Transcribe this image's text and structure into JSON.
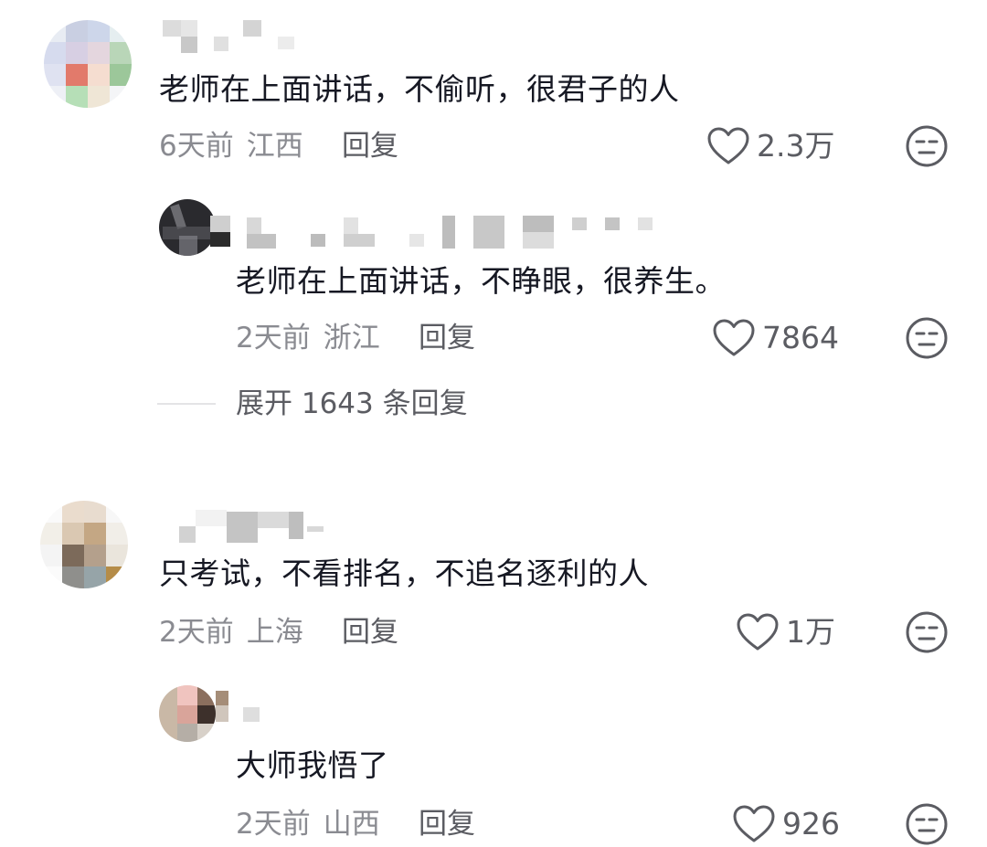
{
  "comments": [
    {
      "text": "老师在上面讲话，不偷听，很君子的人",
      "time": "6天前",
      "location": "江西",
      "reply_label": "回复",
      "likes": "2.3万",
      "replies": [
        {
          "text": "老师在上面讲话，不睁眼，很养生。",
          "time": "2天前",
          "location": "浙江",
          "reply_label": "回复",
          "likes": "7864"
        }
      ],
      "expand_label": "展开 1643 条回复"
    },
    {
      "text": "只考试，不看排名，不追名逐利的人",
      "time": "2天前",
      "location": "上海",
      "reply_label": "回复",
      "likes": "1万",
      "replies": [
        {
          "text": "大师我悟了",
          "time": "2天前",
          "location": "山西",
          "reply_label": "回复",
          "likes": "926"
        }
      ]
    }
  ],
  "icons": {
    "like": "heart-outline-icon",
    "emoji": "neutral-face-icon"
  },
  "colors": {
    "primary_text": "#161823",
    "meta_text": "#8a8b91",
    "action_text": "#5b5c62"
  }
}
